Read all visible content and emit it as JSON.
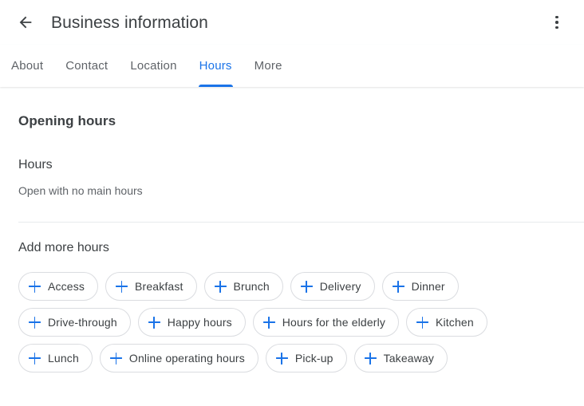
{
  "appbar": {
    "back_icon": "arrow-back-icon",
    "title": "Business information",
    "overflow_icon": "more-vert-icon"
  },
  "tabs": [
    {
      "label": "About",
      "active": false
    },
    {
      "label": "Contact",
      "active": false
    },
    {
      "label": "Location",
      "active": false
    },
    {
      "label": "Hours",
      "active": true
    },
    {
      "label": "More",
      "active": false
    }
  ],
  "main": {
    "section_title": "Opening hours",
    "hours": {
      "label": "Hours",
      "value": "Open with no main hours"
    },
    "add_more": {
      "title": "Add more hours",
      "chip_icon": "plus-icon",
      "chips": [
        {
          "label": "Access"
        },
        {
          "label": "Breakfast"
        },
        {
          "label": "Brunch"
        },
        {
          "label": "Delivery"
        },
        {
          "label": "Dinner"
        },
        {
          "label": "Drive-through"
        },
        {
          "label": "Happy hours"
        },
        {
          "label": "Hours for the elderly"
        },
        {
          "label": "Kitchen"
        },
        {
          "label": "Lunch"
        },
        {
          "label": "Online operating hours"
        },
        {
          "label": "Pick-up"
        },
        {
          "label": "Takeaway"
        }
      ]
    }
  },
  "colors": {
    "accent": "#1a73e8",
    "text_primary": "#3c4043",
    "text_secondary": "#5f6368",
    "border": "#dadce0",
    "divider": "#e8eaed",
    "background": "#ffffff"
  }
}
